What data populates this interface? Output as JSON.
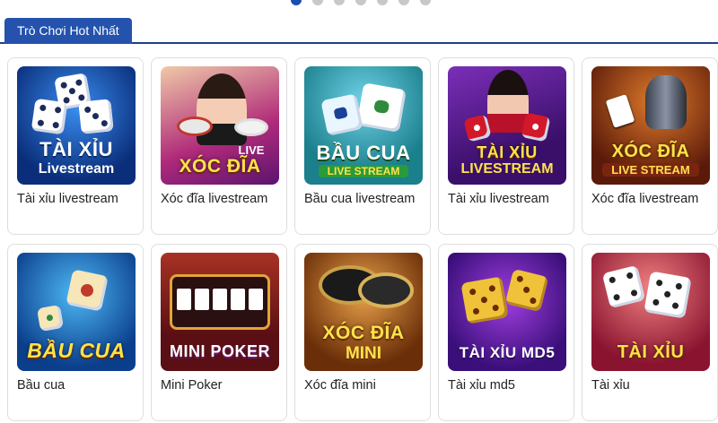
{
  "carousel": {
    "dot_count": 7,
    "active_index": 0
  },
  "section": {
    "title": "Trò Chơi Hot Nhất"
  },
  "games": [
    {
      "label": "Tài xỉu livestream",
      "thumb_title": "TÀI XỈU",
      "thumb_sub": "Livestream"
    },
    {
      "label": "Xóc đĩa livestream",
      "thumb_title": "XÓC ĐĨA",
      "thumb_sub": "LIVE"
    },
    {
      "label": "Bầu cua livestream",
      "thumb_title": "BẦU CUA",
      "thumb_sub": "LIVE STREAM"
    },
    {
      "label": "Tài xỉu livestream",
      "thumb_title": "TÀI XỈU",
      "thumb_sub": "LIVESTREAM"
    },
    {
      "label": "Xóc đĩa livestream",
      "thumb_title": "XÓC ĐĨA",
      "thumb_sub": "LIVE STREAM"
    },
    {
      "label": "Bầu cua",
      "thumb_title": "BẦU CUA",
      "thumb_sub": ""
    },
    {
      "label": "Mini Poker",
      "thumb_title": "MINI POKER",
      "thumb_sub": ""
    },
    {
      "label": "Xóc đĩa mini",
      "thumb_title": "XÓC ĐĨA",
      "thumb_sub": "MINI"
    },
    {
      "label": "Tài xỉu md5",
      "thumb_title": "TÀI XỈU MD5",
      "thumb_sub": ""
    },
    {
      "label": "Tài xỉu",
      "thumb_title": "TÀI XỈU",
      "thumb_sub": ""
    }
  ],
  "colors": {
    "accent": "#2452ad",
    "active_dot": "#1a4fb0",
    "inactive_dot": "#c8c8c8"
  }
}
